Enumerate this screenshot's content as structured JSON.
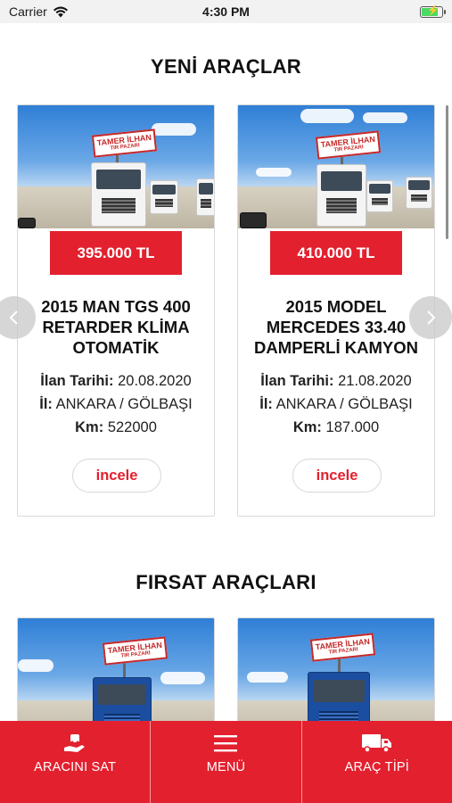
{
  "status_bar": {
    "carrier": "Carrier",
    "time": "4:30 PM",
    "wifi_icon": "wifi-icon",
    "battery_icon": "battery-charging-icon"
  },
  "sections": {
    "new": {
      "title": "YENİ ARAÇLAR",
      "cards": [
        {
          "price": "395.000 TL",
          "title_lines": [
            "2015 MAN TGS 400",
            "RETARDER KLİMA",
            "OTOMATİK"
          ],
          "date_label": "İlan Tarihi:",
          "date_value": "20.08.2020",
          "city_label": "İl:",
          "city_value": "ANKARA / GÖLBAŞI",
          "km_label": "Km:",
          "km_value": "522000",
          "button": "incele",
          "billboard_lines": [
            "TAMER İLHAN",
            "TIR PAZARI"
          ]
        },
        {
          "price": "410.000 TL",
          "title_lines": [
            "2015 MODEL",
            "MERCEDES 33.40",
            "DAMPERLİ KAMYON"
          ],
          "date_label": "İlan Tarihi:",
          "date_value": "21.08.2020",
          "city_label": "İl:",
          "city_value": "ANKARA / GÖLBAŞI",
          "km_label": "Km:",
          "km_value": "187.000",
          "button": "incele",
          "billboard_lines": [
            "TAMER İLHAN",
            "TIR PAZARI"
          ]
        }
      ]
    },
    "deals": {
      "title": "FIRSAT ARAÇLARI",
      "cards": [
        {
          "billboard_lines": [
            "TAMER İLHAN",
            "TIR PAZARI"
          ]
        },
        {
          "billboard_lines": [
            "TAMER İLHAN",
            "TIR PAZARI"
          ]
        }
      ]
    }
  },
  "carousel": {
    "prev_icon": "chevron-left-icon",
    "next_icon": "chevron-right-icon"
  },
  "tab_bar": {
    "items": [
      {
        "label": "ARACINI SAT",
        "icon": "sell-car-hand-icon"
      },
      {
        "label": "MENÜ",
        "icon": "hamburger-menu-icon"
      },
      {
        "label": "ARAÇ TİPİ",
        "icon": "truck-icon"
      }
    ]
  },
  "colors": {
    "accent": "#e3202e",
    "status_bar_bg": "#f2f2f2"
  }
}
